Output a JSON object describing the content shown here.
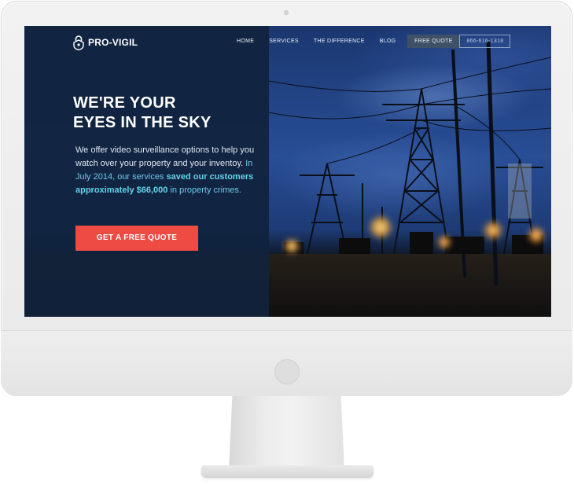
{
  "brand": {
    "name": "PRO-VIGIL"
  },
  "nav": {
    "items": [
      "HOME",
      "SERVICES",
      "THE DIFFERENCE",
      "BLOG"
    ],
    "quote_label": "FREE QUOTE",
    "phone": "866-616-1318"
  },
  "hero": {
    "title_line1": "WE'RE YOUR",
    "title_line2": "EYES IN THE SKY",
    "body_intro": "We offer video surveillance options to help you watch over your property and your inventoy.",
    "body_date": "In July 2014, our services",
    "body_bold": "saved our customers approximately $66,000",
    "body_end": "in property crimes.",
    "cta_label": "GET A FREE QUOTE"
  },
  "colors": {
    "overlay": "#10223c",
    "cta": "#ee4b43",
    "highlight": "#5fd4ea",
    "quote_button": "#3f5166"
  },
  "icons": {
    "brand": "padlock-icon"
  }
}
